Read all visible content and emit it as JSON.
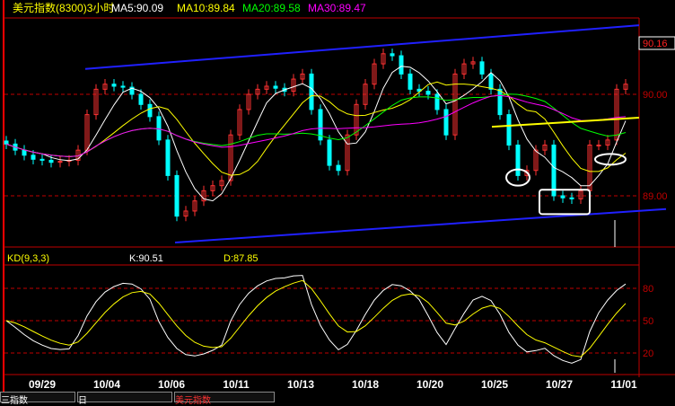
{
  "header": {
    "title": "美元指数(8300)3小时",
    "ma5": "MA5:90.09",
    "ma10": "MA10:89.84",
    "ma20": "MA20:89.58",
    "ma30": "MA30:89.47"
  },
  "kd_header": {
    "name": "KD(9,3,3)",
    "k": "K:90.51",
    "d": "D:87.85"
  },
  "colors": {
    "up": "#ff3232",
    "down": "#00ffff",
    "ma5": "#ffffff",
    "ma10": "#ffff00",
    "ma20": "#00ff00",
    "ma30": "#ff00ff",
    "grid": "#c00000",
    "trend": "#2020ff",
    "support": "#ffff00"
  },
  "chart_data": [
    {
      "type": "candlestick",
      "title": "美元指数(8300)3小时",
      "price_labels": [
        "90.16",
        "90.00",
        "89.00"
      ],
      "ylim": [
        88.45,
        90.75
      ],
      "x_tick_labels": [
        "09/29",
        "10/04",
        "10/06",
        "10/11",
        "10/13",
        "10/18",
        "10/20",
        "10/25",
        "10/27",
        "11/01"
      ],
      "closes": [
        89.51,
        89.45,
        89.4,
        89.36,
        89.35,
        89.33,
        89.34,
        89.35,
        89.45,
        89.8,
        90.05,
        90.1,
        90.08,
        90.07,
        90.0,
        89.9,
        89.78,
        89.55,
        89.2,
        88.8,
        88.85,
        88.95,
        89.05,
        89.1,
        89.15,
        89.6,
        89.85,
        90.0,
        90.05,
        90.08,
        90.06,
        90.03,
        90.15,
        90.2,
        89.85,
        89.55,
        89.3,
        89.25,
        89.6,
        89.9,
        90.1,
        90.3,
        90.4,
        90.38,
        90.2,
        90.05,
        90.03,
        90.0,
        89.85,
        89.6,
        90.2,
        90.3,
        90.32,
        90.2,
        90.05,
        89.8,
        89.5,
        89.2,
        89.25,
        89.45,
        89.5,
        89.0,
        88.98,
        88.97,
        89.05,
        89.5,
        89.5,
        89.55,
        90.05,
        90.1
      ],
      "moving_averages": [
        5,
        10,
        20,
        30
      ],
      "trend_lines": [
        {
          "color": "blue",
          "from": [
            9,
            90.25
          ],
          "to": [
            70.7,
            90.68
          ]
        },
        {
          "color": "blue",
          "from": [
            19,
            88.54
          ],
          "to": [
            73.7,
            88.87
          ]
        },
        {
          "color": "yellow",
          "from": [
            54.3,
            89.68
          ],
          "to": [
            70.7,
            89.77
          ]
        }
      ],
      "annotations": [
        {
          "shape": "ellipse",
          "bar": 57.2,
          "price": 89.18
        },
        {
          "shape": "rectangle",
          "bars": [
            59.6,
            65.2
          ],
          "prices": [
            88.82,
            89.06
          ]
        },
        {
          "shape": "ellipse",
          "bar": 67.5,
          "price": 89.36
        }
      ]
    },
    {
      "type": "line",
      "title": "KD(9,3,3)",
      "series": [
        {
          "name": "K",
          "last": 90.51
        },
        {
          "name": "D",
          "last": 87.85
        }
      ],
      "y_tick_labels": [
        "80",
        "50",
        "20"
      ],
      "ylim": [
        5,
        100
      ]
    }
  ],
  "tabs": [
    "三指数",
    "日",
    "美元指数"
  ]
}
